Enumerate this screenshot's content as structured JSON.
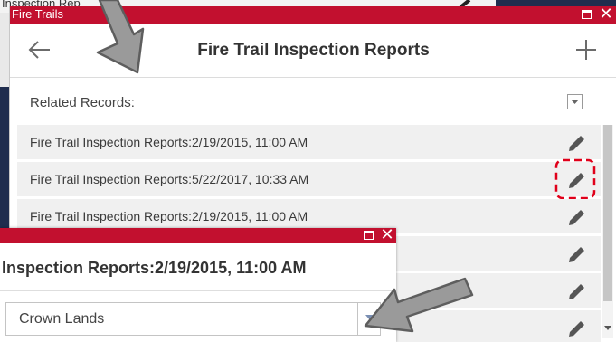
{
  "background": {
    "title": "Inspection Rep"
  },
  "panel": {
    "titlebar": "Fire Trails",
    "header_title": "Fire Trail Inspection Reports",
    "related_label": "Related Records:",
    "records": [
      {
        "label": "Fire Trail Inspection Reports:2/19/2015, 11:00 AM"
      },
      {
        "label": "Fire Trail Inspection Reports:5/22/2017, 10:33 AM",
        "highlighted": true
      },
      {
        "label": "Fire Trail Inspection Reports:2/19/2015, 11:00 AM"
      },
      {
        "label": ""
      },
      {
        "label": ""
      },
      {
        "label": ""
      }
    ],
    "icons": {
      "back": "arrow-left-icon",
      "add": "plus-icon",
      "edit": "pencil-icon",
      "dropdown": "chevron-down-icon",
      "maximize": "maximize-icon",
      "close": "close-icon"
    }
  },
  "popup": {
    "title": "Inspection Reports:2/19/2015, 11:00 AM",
    "select_value": "Crown Lands",
    "close_glyph": "✕"
  },
  "colors": {
    "titlebar": "#c2102f",
    "highlight": "#e0001a",
    "arrow": "#9a9a9a",
    "navy": "#1f2d4e"
  }
}
